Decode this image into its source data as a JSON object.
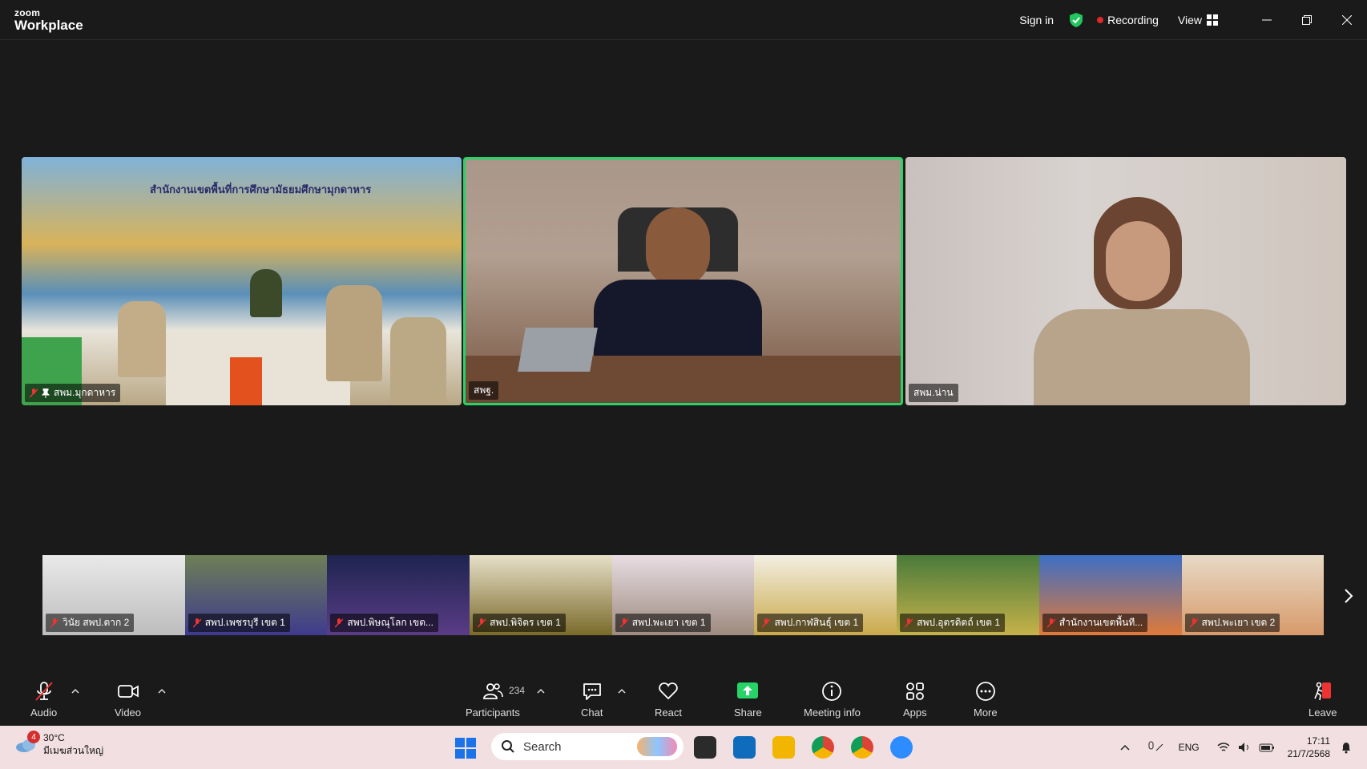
{
  "app": {
    "logo_line1": "zoom",
    "logo_line2": "Workplace"
  },
  "titlebar": {
    "signin": "Sign in",
    "recording": "Recording",
    "view": "View"
  },
  "tiles": [
    {
      "name": "สพม.มุกดาหาร",
      "banner": "สำนักงานเขตพื้นที่การศึกษามัธยมศึกษามุกดาหาร"
    },
    {
      "name": "สพฐ."
    },
    {
      "name": "สพม.น่าน"
    }
  ],
  "thumbnails": [
    {
      "name": "วินัย สพป.ตาก 2"
    },
    {
      "name": "สพป.เพชรบุรี เขต 1"
    },
    {
      "name": "สพป.พิษณุโลก เขต..."
    },
    {
      "name": "สพป.พิจิตร เขต 1"
    },
    {
      "name": "สพป.พะเยา เขต 1"
    },
    {
      "name": "สพป.กาฬสินธุ์ เขต 1"
    },
    {
      "name": "สพป.อุตรดิตถ์ เขต 1"
    },
    {
      "name": "สำนักงานเขตพื้นที..."
    },
    {
      "name": "สพป.พะเยา เขต 2"
    }
  ],
  "toolbar": {
    "audio": "Audio",
    "video": "Video",
    "participants": "Participants",
    "participants_count": "234",
    "chat": "Chat",
    "react": "React",
    "share": "Share",
    "meeting_info": "Meeting info",
    "apps": "Apps",
    "more": "More",
    "leave": "Leave"
  },
  "taskbar": {
    "weather_temp": "30°C",
    "weather_desc": "มีเมฆส่วนใหญ่",
    "weather_badge": "4",
    "search_placeholder": "Search",
    "lang": "ENG",
    "time": "17:11",
    "date": "21/7/2568"
  },
  "colors": {
    "active_speaker": "#25d366",
    "recording_dot": "#e02828",
    "share_green": "#25d366"
  }
}
